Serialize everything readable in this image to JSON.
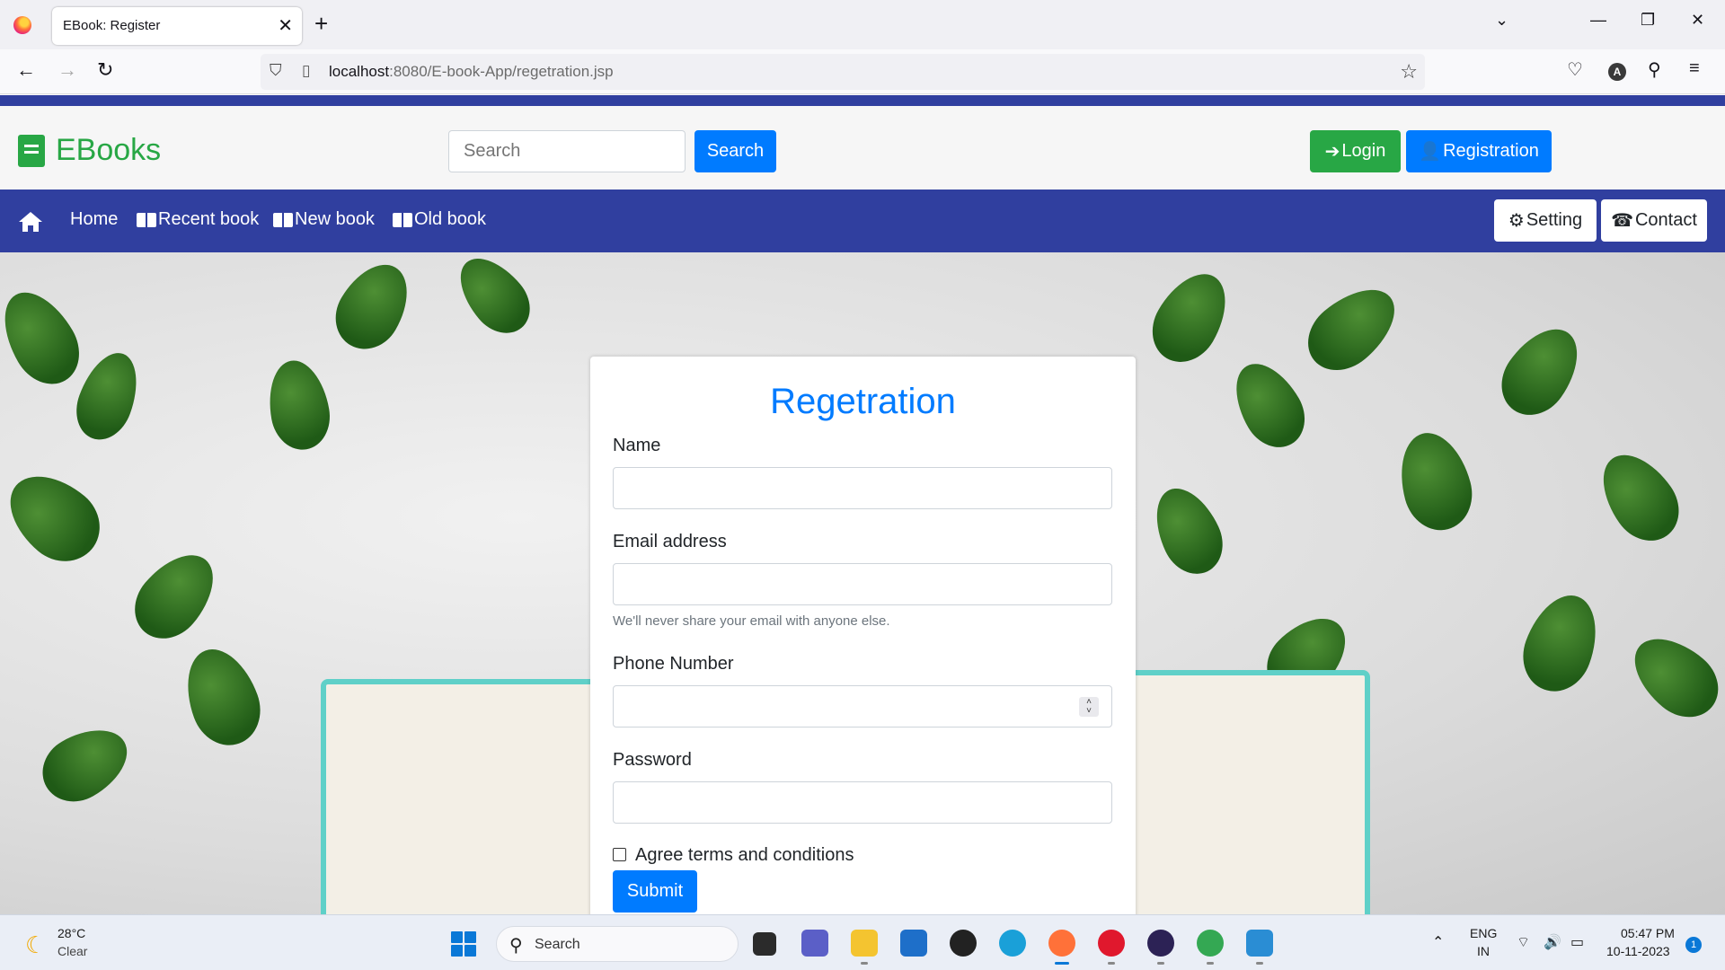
{
  "browser": {
    "tab_title": "EBook: Register",
    "url_host": "localhost",
    "url_rest": ":8080/E-book-App/regetration.jsp"
  },
  "header": {
    "brand": "EBooks",
    "search_placeholder": "Search",
    "search_button": "Search",
    "login_button": "Login",
    "registration_button": "Registration"
  },
  "nav": {
    "home": "Home",
    "recent": "Recent book",
    "new": "New book",
    "old": "Old book",
    "setting": "Setting",
    "contact": "Contact"
  },
  "form": {
    "title": "Regetration",
    "name_label": "Name",
    "email_label": "Email address",
    "email_help": "We'll never share your email with anyone else.",
    "phone_label": "Phone Number",
    "password_label": "Password",
    "terms_label": "Agree terms and conditions",
    "submit_label": "Submit"
  },
  "taskbar": {
    "temperature": "28°C",
    "weather": "Clear",
    "search": "Search",
    "lang": "ENG",
    "region": "IN",
    "time": "05:47 PM",
    "date": "10-11-2023",
    "notifications": "1"
  },
  "colors": {
    "primary": "#007bff",
    "success": "#28a745",
    "nav": "#303f9f"
  }
}
